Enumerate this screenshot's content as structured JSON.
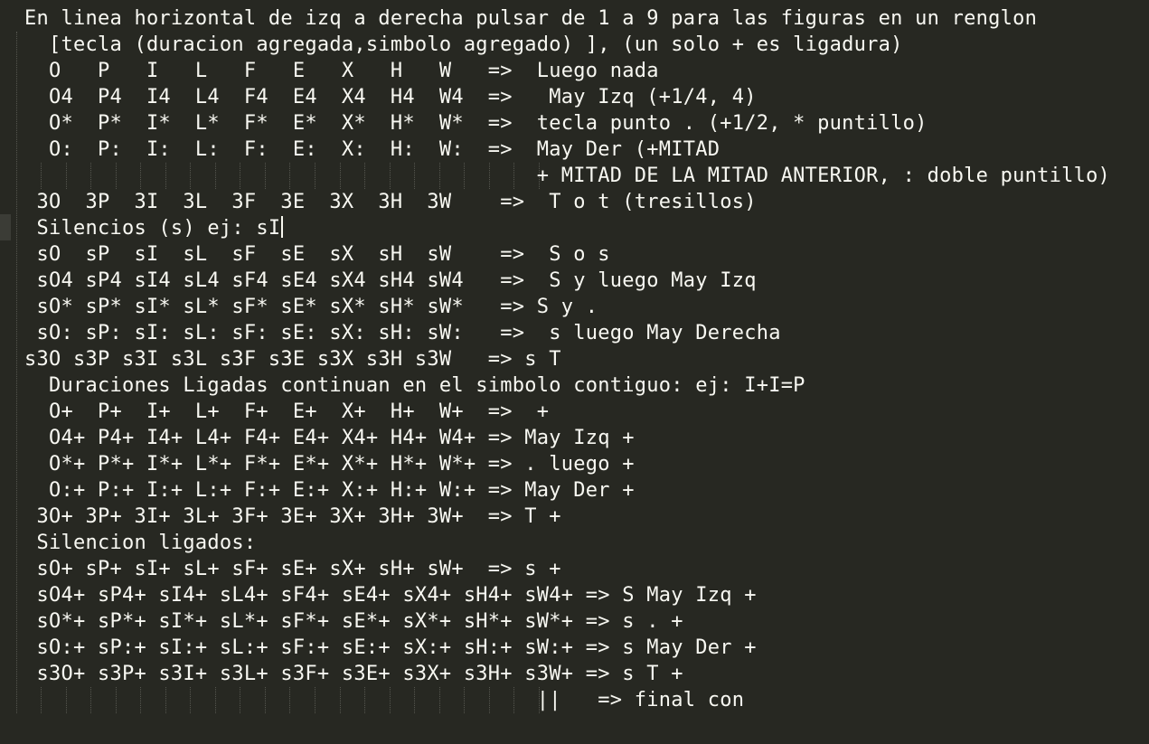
{
  "editor": {
    "lines": [
      "  En linea horizontal de izq a derecha pulsar de 1 a 9 para las figuras en un renglon",
      "    [tecla (duracion agregada,simbolo agregado) ], (un solo + es ligadura)",
      "    O   P   I   L   F   E   X   H   W   =>  Luego nada",
      "    O4  P4  I4  L4  F4  E4  X4  H4  W4  =>   May Izq (+1/4, 4)",
      "    O*  P*  I*  L*  F*  E*  X*  H*  W*  =>  tecla punto . (+1/2, * puntillo)",
      "    O:  P:  I:  L:  F:  E:  X:  H:  W:  =>  May Der (+MITAD",
      "                                            + MITAD DE LA MITAD ANTERIOR, : doble puntillo)",
      "   3O  3P  3I  3L  3F  3E  3X  3H  3W    =>  T o t (tresillos)",
      "   Silencios (s) ej: sI",
      "   sO  sP  sI  sL  sF  sE  sX  sH  sW    =>  S o s",
      "   sO4 sP4 sI4 sL4 sF4 sE4 sX4 sH4 sW4   =>  S y luego May Izq",
      "   sO* sP* sI* sL* sF* sE* sX* sH* sW*   => S y .",
      "   sO: sP: sI: sL: sF: sE: sX: sH: sW:   =>  s luego May Derecha",
      "  s3O s3P s3I s3L s3F s3E s3X s3H s3W   => s T",
      "    Duraciones Ligadas continuan en el simbolo contiguo: ej: I+I=P",
      "    O+  P+  I+  L+  F+  E+  X+  H+  W+  =>  +",
      "    O4+ P4+ I4+ L4+ F4+ E4+ X4+ H4+ W4+ => May Izq +",
      "    O*+ P*+ I*+ L*+ F*+ E*+ X*+ H*+ W*+ => . luego +",
      "    O:+ P:+ I:+ L:+ F:+ E:+ X:+ H:+ W:+ => May Der +",
      "   3O+ 3P+ 3I+ 3L+ 3F+ 3E+ 3X+ 3H+ 3W+  => T +",
      "   Silencion ligados:",
      "   sO+ sP+ sI+ sL+ sF+ sE+ sX+ sH+ sW+  => s +",
      "   sO4+ sP4+ sI4+ sL4+ sF4+ sE4+ sX4+ sH4+ sW4+ => S May Izq +",
      "   sO*+ sP*+ sI*+ sL*+ sF*+ sE*+ sX*+ sH*+ sW*+ => s . +",
      "   sO:+ sP:+ sI:+ sL:+ sF:+ sE:+ sX:+ sH:+ sW:+ => s May Der +",
      "   s3O+ s3P+ s3I+ s3L+ s3F+ s3E+ s3X+ s3H+ s3W+ => s T +",
      "                                            ||   => final con"
    ],
    "cursor_line": 8
  },
  "colors": {
    "background": "#272822",
    "text": "#f8f8f2",
    "indent_guide": "#55564f"
  }
}
